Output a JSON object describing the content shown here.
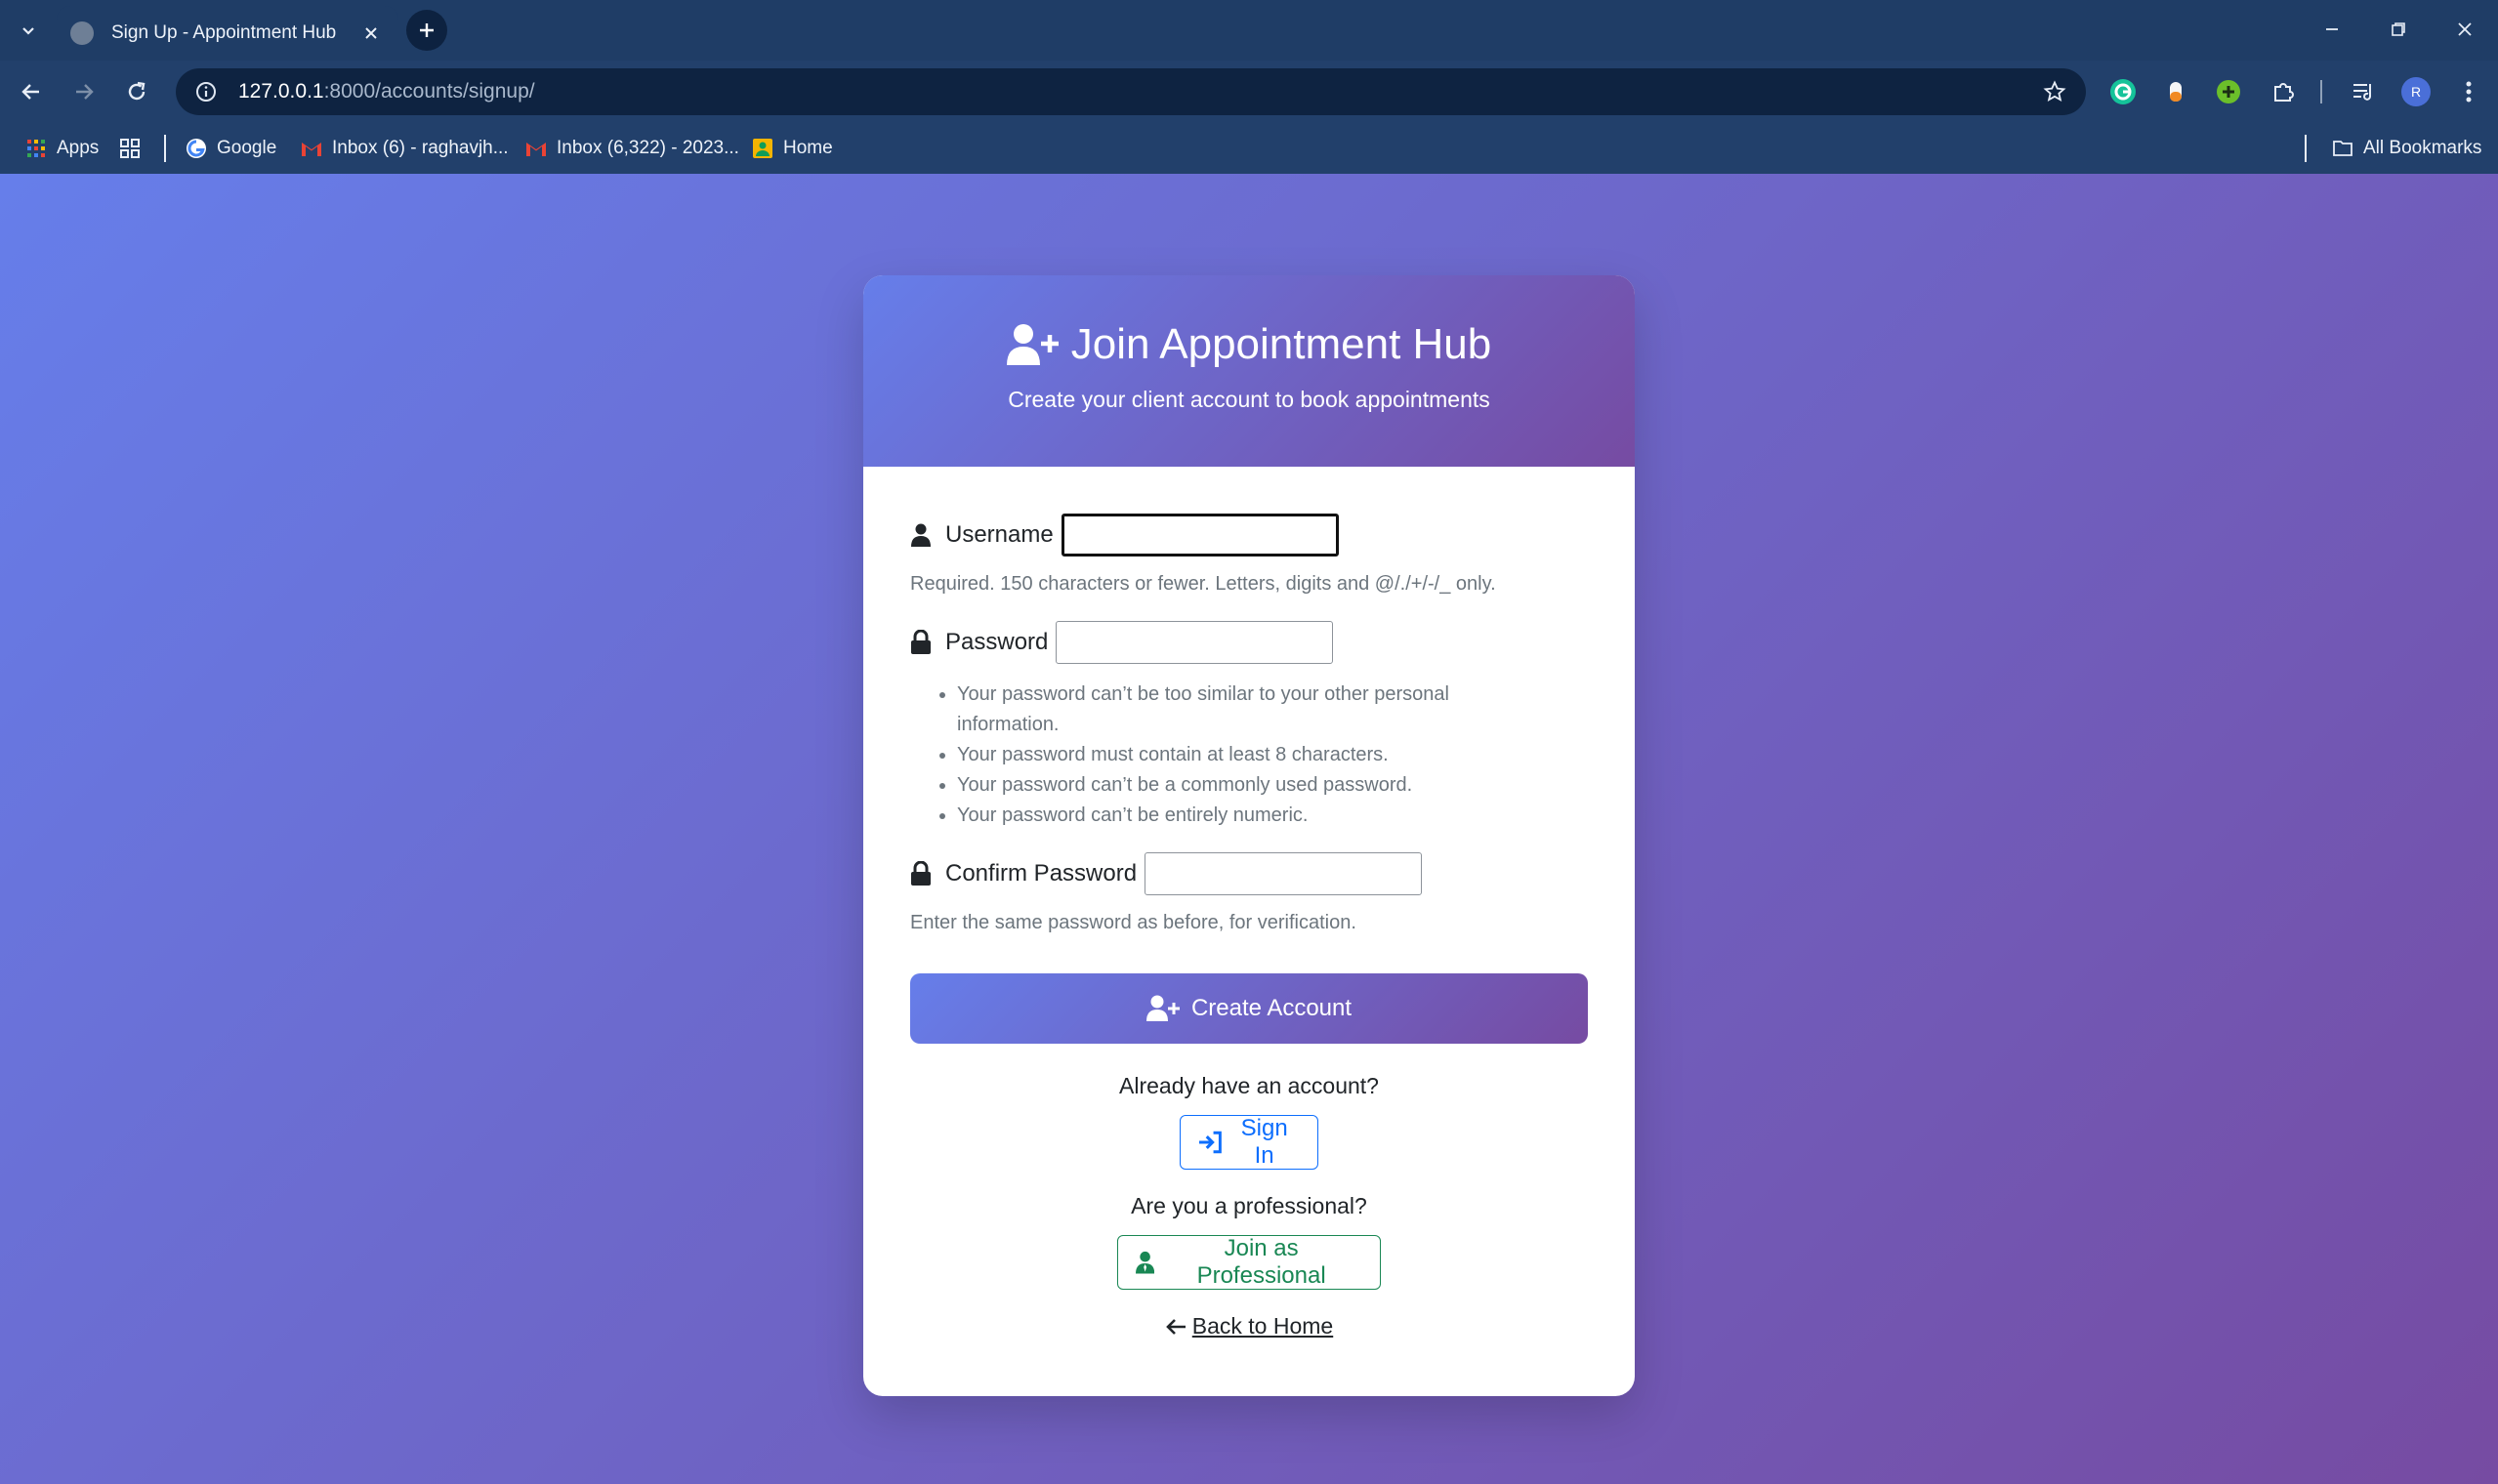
{
  "browser": {
    "tab_title": "Sign Up - Appointment Hub",
    "url_host": "127.0.0.1",
    "url_rest": ":8000/accounts/signup/",
    "profile_initial": "R"
  },
  "bookmarks": {
    "items": [
      {
        "label": "Apps",
        "icon": "apps-grid-icon"
      },
      {
        "label": "Google",
        "icon": "google-icon"
      },
      {
        "label": "Inbox (6) - raghavjh...",
        "icon": "gmail-icon"
      },
      {
        "label": "Inbox (6,322) - 2023...",
        "icon": "gmail-icon"
      },
      {
        "label": "Home",
        "icon": "home-icon"
      }
    ],
    "all_bookmarks": "All Bookmarks"
  },
  "card": {
    "title": "Join Appointment Hub",
    "subtitle": "Create your client account to book appointments"
  },
  "form": {
    "username_label": "Username",
    "username_value": "",
    "username_help": "Required. 150 characters or fewer. Letters, digits and @/./+/-/_ only.",
    "password_label": "Password",
    "password_value": "",
    "password_rules": [
      "Your password can’t be too similar to your other personal information.",
      "Your password must contain at least 8 characters.",
      "Your password can’t be a commonly used password.",
      "Your password can’t be entirely numeric."
    ],
    "confirm_label": "Confirm Password",
    "confirm_value": "",
    "confirm_help": "Enter the same password as before, for verification.",
    "submit_label": "Create Account"
  },
  "links": {
    "have_account": "Already have an account?",
    "sign_in": "Sign In",
    "professional_prompt": "Are you a professional?",
    "join_professional": "Join as Professional",
    "back_home": "Back to Home"
  },
  "colors": {
    "gradient_start": "#667eea",
    "gradient_end": "#764ba2",
    "link_blue": "#0d6efd",
    "success_green": "#198754"
  }
}
